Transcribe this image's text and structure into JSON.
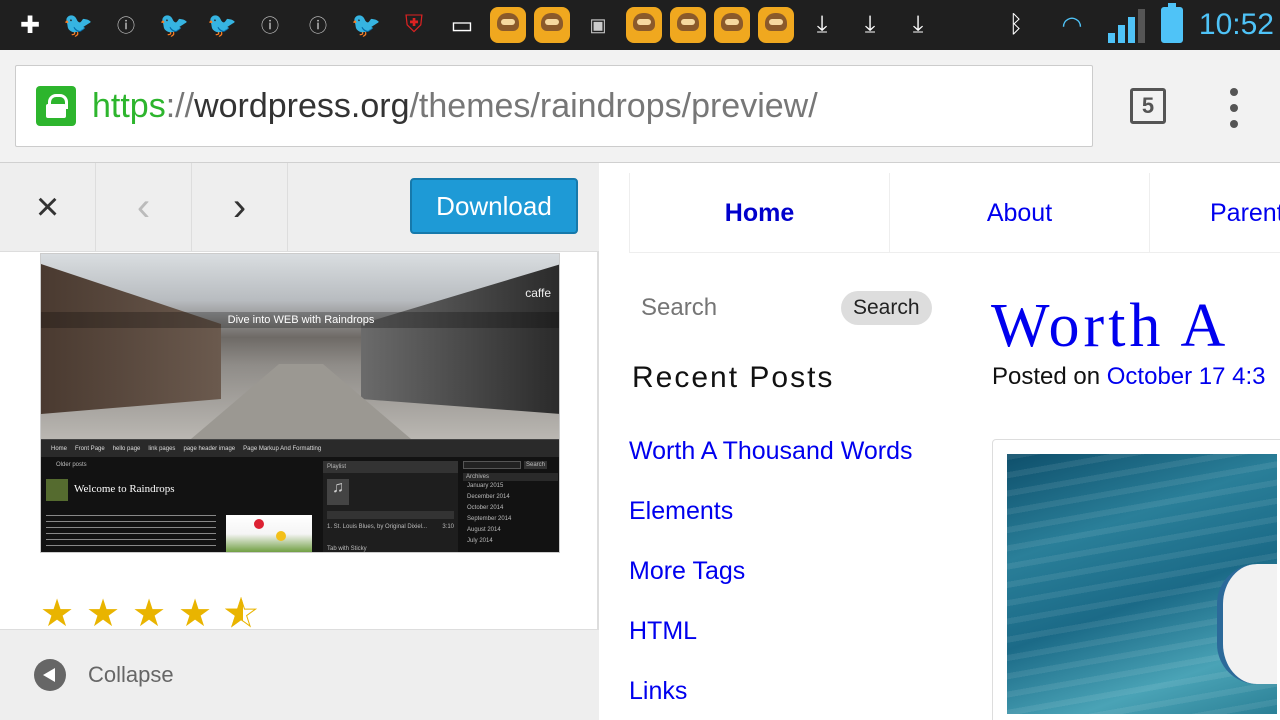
{
  "status_bar": {
    "time": "10:52",
    "icons": [
      "plus-box-icon",
      "twitter-icon",
      "info-icon",
      "twitter-icon",
      "twitter-icon",
      "info-icon",
      "info-icon",
      "twitter-icon",
      "shield-alert-icon",
      "screen-icon",
      "line-sticker-icon",
      "line-sticker-icon",
      "app-icon",
      "line-sticker-icon",
      "line-sticker-icon",
      "line-sticker-icon",
      "line-sticker-icon",
      "download-icon",
      "download-icon",
      "download-icon"
    ],
    "right_icons": [
      "bluetooth-icon",
      "wifi-icon",
      "signal-icon",
      "battery-icon"
    ]
  },
  "browser": {
    "url_scheme": "https",
    "url_sep": "://",
    "url_host": "wordpress.org",
    "url_path": "/themes/raindrops/preview/",
    "tab_count": "5"
  },
  "preview_panel": {
    "close_label": "×",
    "prev_label": "‹",
    "next_label": "›",
    "download_label": "Download",
    "collapse_label": "Collapse",
    "rating": 4.5,
    "rating_max": 5,
    "thumbnail": {
      "caption": "Dive into WEB with Raindrops",
      "shop_sign": "caffe",
      "nav": [
        "Home",
        "Front Page",
        "hello page",
        "link pages",
        "page header image",
        "Page Markup And Formatting"
      ],
      "welcome": "Welcome to Raindrops",
      "older_posts": "Older posts",
      "playlist": "Playlist",
      "track": "1. St. Louis Blues, by Original Dixiel...",
      "track_time": "3:10",
      "search_btn": "Search",
      "archives": "Archives",
      "archive_items": [
        "January 2015",
        "December 2014",
        "October 2014",
        "September 2014",
        "August 2014",
        "July 2014"
      ],
      "tab_widget": "Tab with Sticky"
    }
  },
  "site": {
    "nav": [
      "Home",
      "About",
      "Parent"
    ],
    "search_placeholder": "Search",
    "search_button": "Search",
    "recent_posts_title": "Recent Posts",
    "recent_posts": [
      "Worth A Thousand Words",
      "Elements",
      "More Tags",
      "HTML",
      "Links"
    ],
    "post_title": "Worth A",
    "posted_on_label": "Posted on",
    "posted_on_date": "October 17 4:3"
  }
}
